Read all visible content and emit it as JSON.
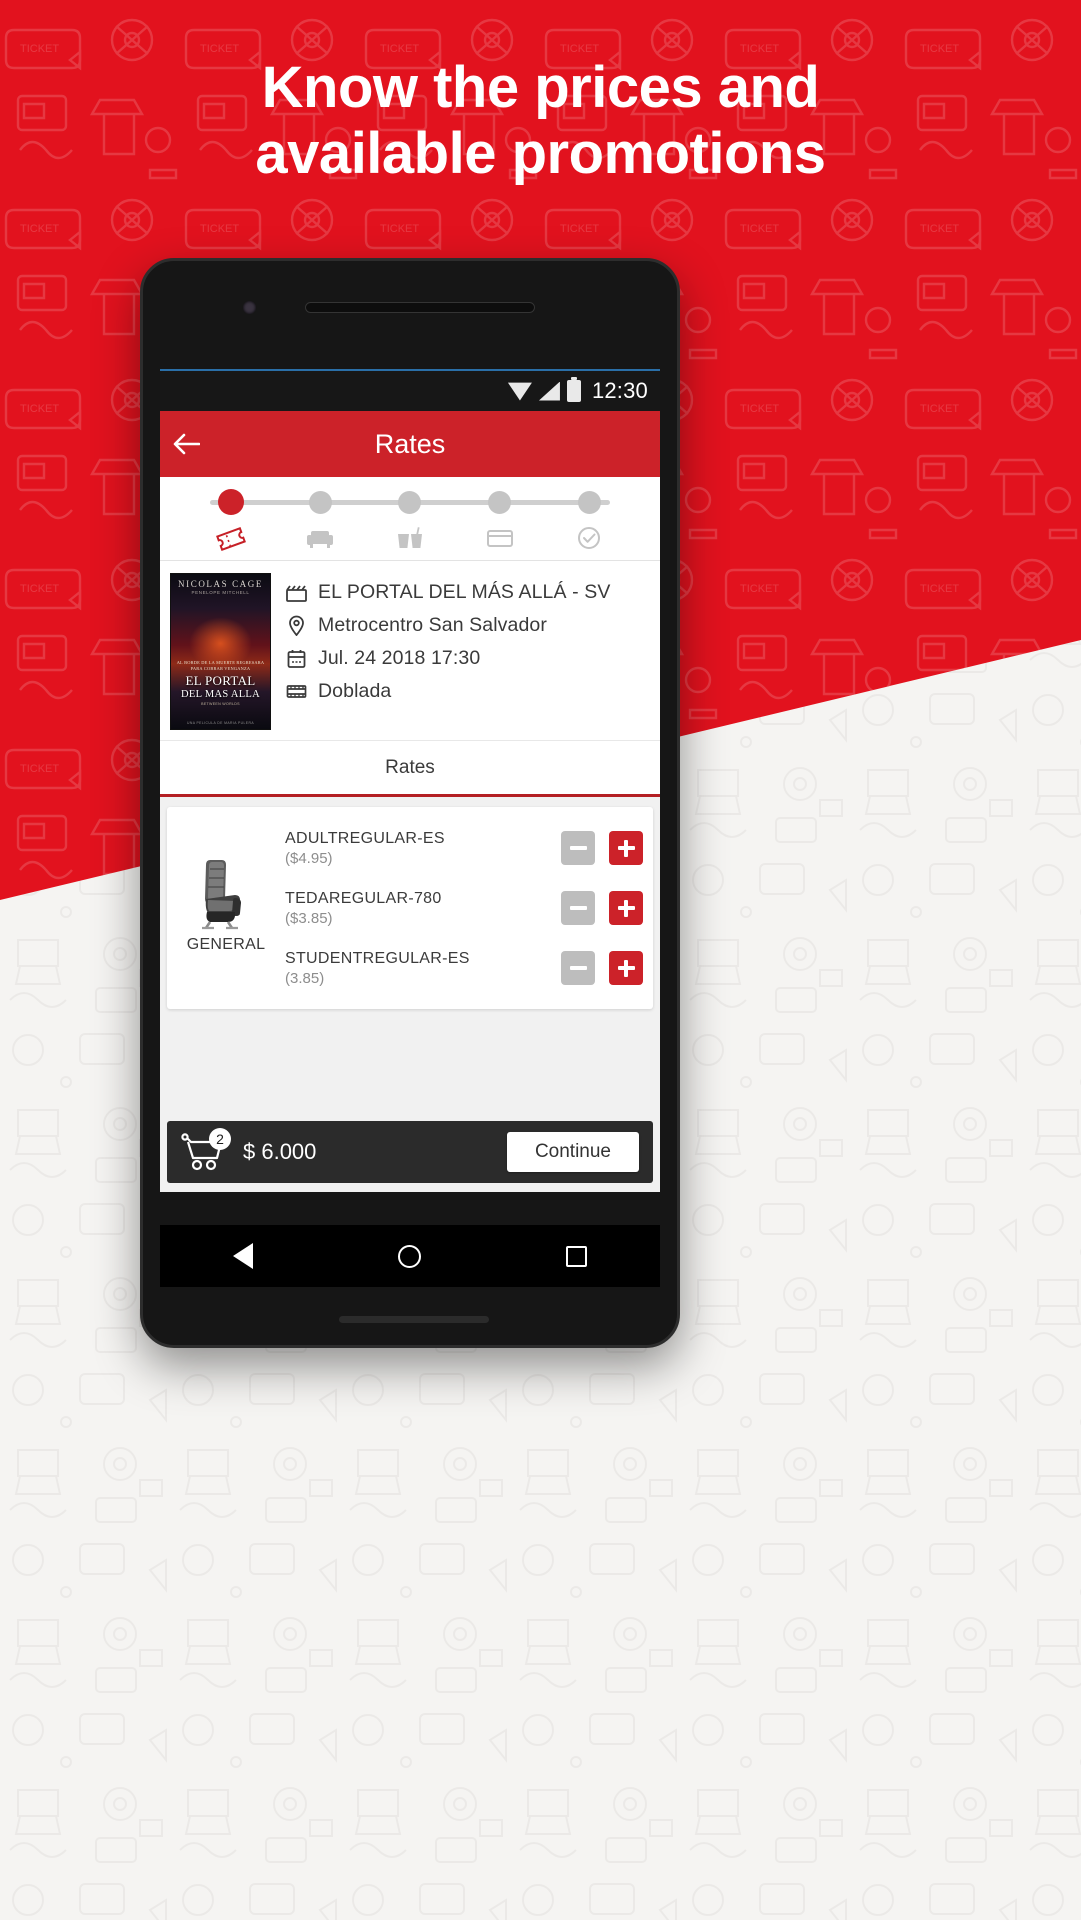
{
  "promo": {
    "headline_line1": "Know the prices and",
    "headline_line2": "available promotions",
    "background_color": "#e2121e"
  },
  "status_bar": {
    "time": "12:30",
    "icons": [
      "wifi-icon",
      "signal-icon",
      "battery-icon"
    ]
  },
  "app_bar": {
    "back_icon": "back-arrow-icon",
    "title": "Rates",
    "color": "#cc2229"
  },
  "stepper": {
    "active_index": 0,
    "steps": [
      {
        "icon": "ticket-icon",
        "state": "active"
      },
      {
        "icon": "seat-icon",
        "state": "inactive"
      },
      {
        "icon": "snacks-icon",
        "state": "inactive"
      },
      {
        "icon": "credit-card-icon",
        "state": "inactive"
      },
      {
        "icon": "check-circle-icon",
        "state": "inactive"
      }
    ]
  },
  "movie": {
    "poster": {
      "actor": "NICOLAS CAGE",
      "costars": "PENELOPE MITCHELL",
      "tagline_line1": "AL BORDE DE LA MUERTE REGRESARA",
      "tagline_line2": "PARA COBRAR VENGANZA",
      "title_line1": "EL PORTAL",
      "title_line2": "DEL MAS ALLA",
      "credit": "BETWEEN WORLDS",
      "footer": "UNA PELICULA DE MARIA PULERA"
    },
    "rows": [
      {
        "icon": "clapperboard-icon",
        "text": "EL PORTAL DEL MÁS ALLÁ - SV"
      },
      {
        "icon": "location-pin-icon",
        "text": "Metrocentro San Salvador"
      },
      {
        "icon": "calendar-icon",
        "text": "Jul. 24  2018 17:30"
      },
      {
        "icon": "film-strip-icon",
        "text": "Doblada"
      }
    ]
  },
  "rates_tab": {
    "label": "Rates",
    "underline_color": "#b41f24"
  },
  "rates_list": {
    "seat_category": {
      "icon": "cinema-seat-icon",
      "label": "GENERAL"
    },
    "rows": [
      {
        "name": "ADULTREGULAR-ES",
        "price": "($4.95)",
        "minus_label": "−",
        "plus_label": "+"
      },
      {
        "name": "TEDAREGULAR-780",
        "price": "($3.85)",
        "minus_label": "−",
        "plus_label": "+"
      },
      {
        "name": "STUDENTREGULAR-ES",
        "price": "(3.85)",
        "minus_label": "−",
        "plus_label": "+"
      }
    ]
  },
  "cart_bar": {
    "cart_icon": "shopping-cart-icon",
    "badge_count": "2",
    "total": "$ 6.000",
    "continue_label": "Continue"
  },
  "nav_bar": {
    "back": "nav-back-icon",
    "home": "nav-home-icon",
    "recents": "nav-recents-icon"
  }
}
